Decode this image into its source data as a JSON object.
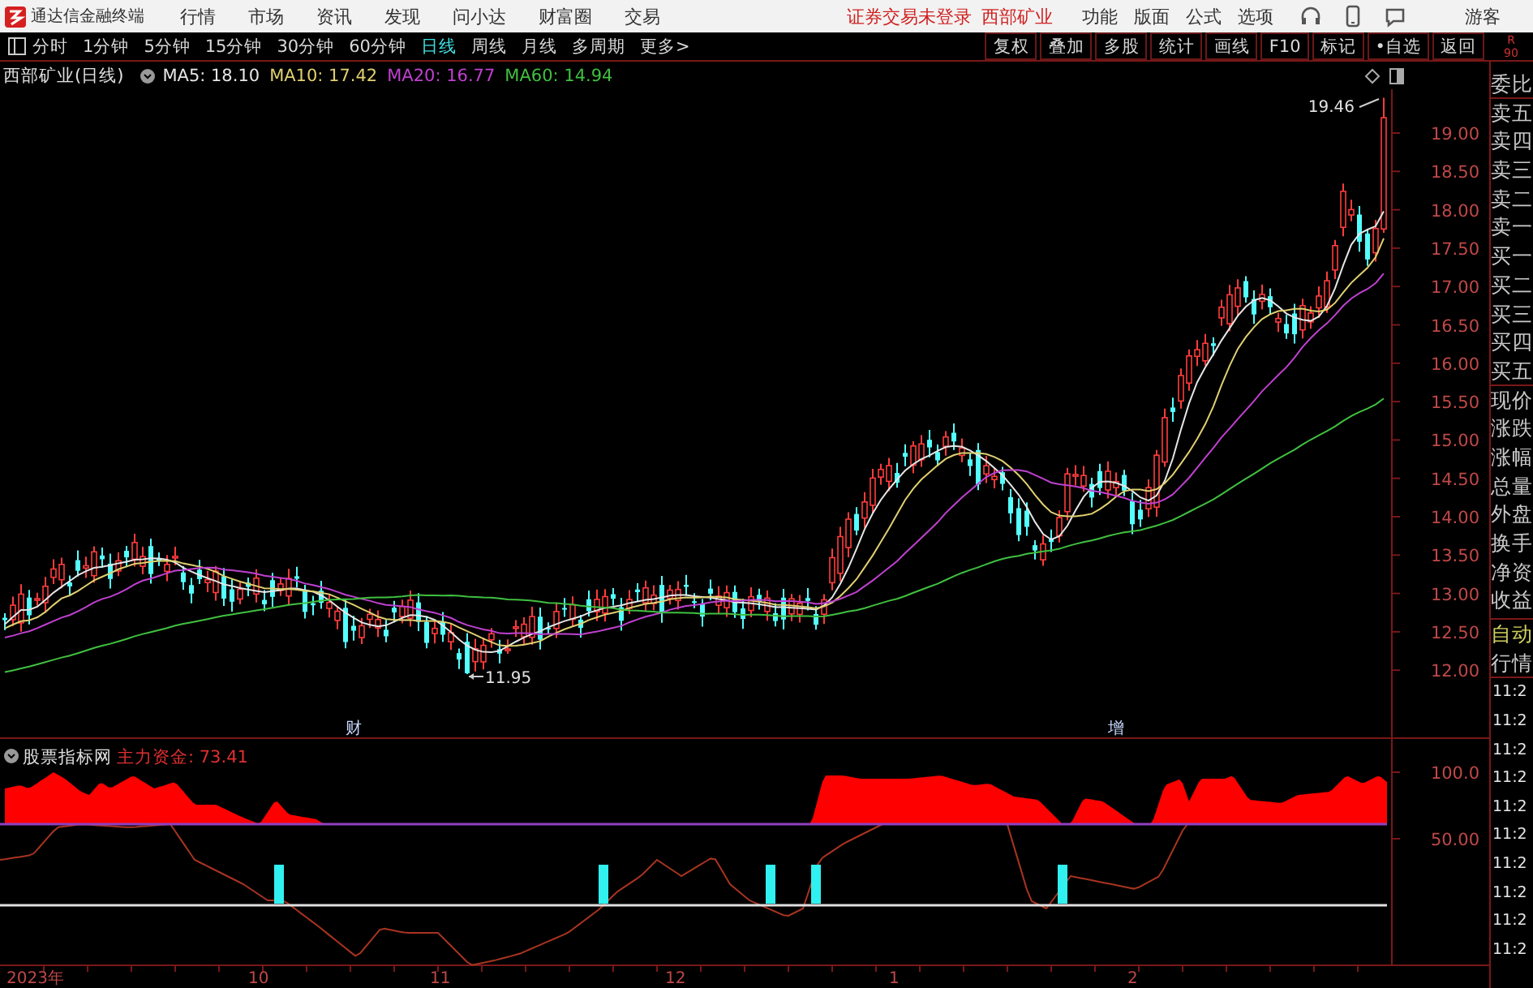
{
  "app": {
    "title": "通达信金融终端"
  },
  "menu": [
    "行情",
    "市场",
    "资讯",
    "发现",
    "问小达",
    "财富圈",
    "交易"
  ],
  "notice": "证券交易未登录",
  "stock_name": "西部矿业",
  "right_menu": [
    "功能",
    "版面",
    "公式",
    "选项"
  ],
  "user": "游客",
  "periods": [
    {
      "label": "分时",
      "selected": false
    },
    {
      "label": "1分钟",
      "selected": false
    },
    {
      "label": "5分钟",
      "selected": false
    },
    {
      "label": "15分钟",
      "selected": false
    },
    {
      "label": "30分钟",
      "selected": false
    },
    {
      "label": "60分钟",
      "selected": false
    },
    {
      "label": "日线",
      "selected": true
    },
    {
      "label": "周线",
      "selected": false
    },
    {
      "label": "月线",
      "selected": false
    },
    {
      "label": "多周期",
      "selected": false
    },
    {
      "label": "更多>",
      "selected": false
    }
  ],
  "tools": [
    "复权",
    "叠加",
    "多股",
    "统计",
    "画线",
    "F10",
    "标记",
    "•自选",
    "返回"
  ],
  "side_header": [
    "R",
    "90"
  ],
  "chart": {
    "title": "西部矿业(日线)",
    "ma": [
      {
        "label": "MA5: 18.10",
        "color": "#e6e6e6"
      },
      {
        "label": "MA10: 17.42",
        "color": "#e0d070"
      },
      {
        "label": "MA20: 16.77",
        "color": "#c040d0"
      },
      {
        "label": "MA60: 14.94",
        "color": "#40c040"
      }
    ],
    "price_ticks": [
      "19.00",
      "18.50",
      "18.00",
      "17.50",
      "17.00",
      "16.50",
      "16.00",
      "15.50",
      "15.00",
      "14.50",
      "14.00",
      "13.50",
      "13.00",
      "12.50",
      "12.00"
    ],
    "high_label": "19.46",
    "low_label": "11.95",
    "event_marks": [
      "财",
      "增"
    ]
  },
  "indicator": {
    "name": "股票指标网",
    "reading": "主力资金: 73.41",
    "ticks": [
      "100.0",
      "50.00"
    ]
  },
  "dates": [
    "2023年",
    "10",
    "11",
    "12",
    "1",
    "2"
  ],
  "quote_labels": [
    "委比",
    "卖五",
    "卖四",
    "卖三",
    "卖二",
    "卖一",
    "买一",
    "买二",
    "买三",
    "买四",
    "买五",
    "现价",
    "涨跌",
    "涨幅",
    "总量",
    "外盘",
    "换手",
    "净资",
    "收益"
  ],
  "modes": [
    {
      "label": "自动",
      "selected": true
    },
    {
      "label": "行情",
      "selected": false
    }
  ],
  "times": [
    "11:2",
    "11:2",
    "11:2",
    "11:2",
    "11:2",
    "11:2",
    "11:2",
    "11:2",
    "11:2",
    "11:2"
  ]
}
